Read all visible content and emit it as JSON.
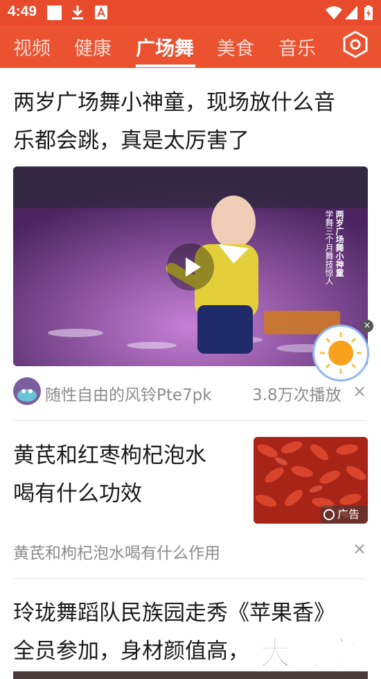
{
  "status_bar": {
    "time": "4:49"
  },
  "tabs": [
    {
      "label": "视频",
      "active": false
    },
    {
      "label": "健康",
      "active": false
    },
    {
      "label": "广场舞",
      "active": true
    },
    {
      "label": "美食",
      "active": false
    },
    {
      "label": "音乐",
      "active": false
    }
  ],
  "colors": {
    "header": "#e84a2c",
    "accent_text": "#ffffff"
  },
  "feed": {
    "item1": {
      "title_line1": "两岁广场舞小神童，现场放什么音",
      "title_line2": "乐都会跳，真是太厉害了",
      "video_caption_col1": "两岁广场舞小神童",
      "video_caption_col2": "学舞三个月舞技惊人",
      "author": "随性自由的风铃Pte7pk",
      "plays": "3.8万次播放"
    },
    "item2": {
      "title_line1": "黄芪和红枣枸杞泡水",
      "title_line2": "喝有什么功效",
      "ad_label": "广告",
      "subtitle": "黄芪和枸杞泡水喝有什么作用"
    },
    "item3": {
      "title_line1": "玲珑舞蹈队民族园走秀《苹果香》",
      "title_line2": "全员参加，身材颜值高，",
      "watermark": "大玩家"
    }
  }
}
